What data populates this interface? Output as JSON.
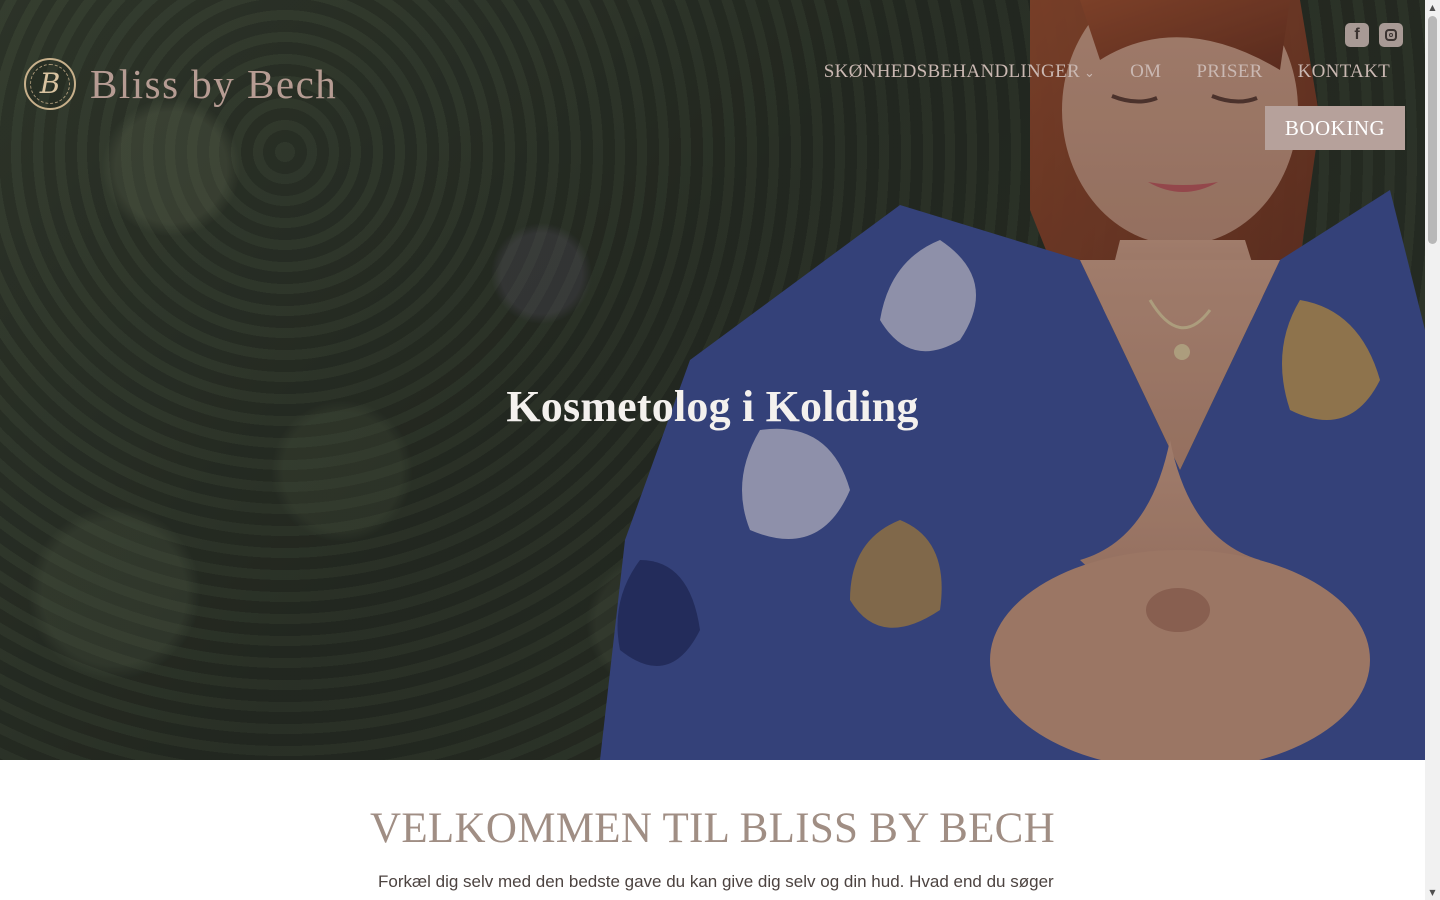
{
  "brand": {
    "monogram": "B",
    "name": "Bliss by Bech"
  },
  "social": {
    "facebook_label": "f"
  },
  "nav": {
    "items": [
      {
        "label": "SKØNHEDSBEHANDLINGER",
        "has_dropdown": true
      },
      {
        "label": "OM"
      },
      {
        "label": "PRISER"
      },
      {
        "label": "KONTAKT"
      }
    ],
    "booking_label": "BOOKING",
    "chevron": "⌄"
  },
  "hero": {
    "title": "Kosmetolog i Kolding"
  },
  "welcome": {
    "heading": "VELKOMMEN TIL BLISS BY BECH",
    "intro": "Forkæl dig selv med den bedste gave du kan give dig selv og din hud. Hvad end du søger en afslappende"
  },
  "colors": {
    "accent": "#b6a19b",
    "heading": "#a08e84",
    "nav_text": "#cab8b2",
    "logo_gold": "#c7b08b"
  },
  "icons": {
    "logo": "monogram-circle-icon",
    "facebook": "facebook-icon",
    "instagram": "instagram-icon",
    "dropdown": "chevron-down-icon"
  }
}
